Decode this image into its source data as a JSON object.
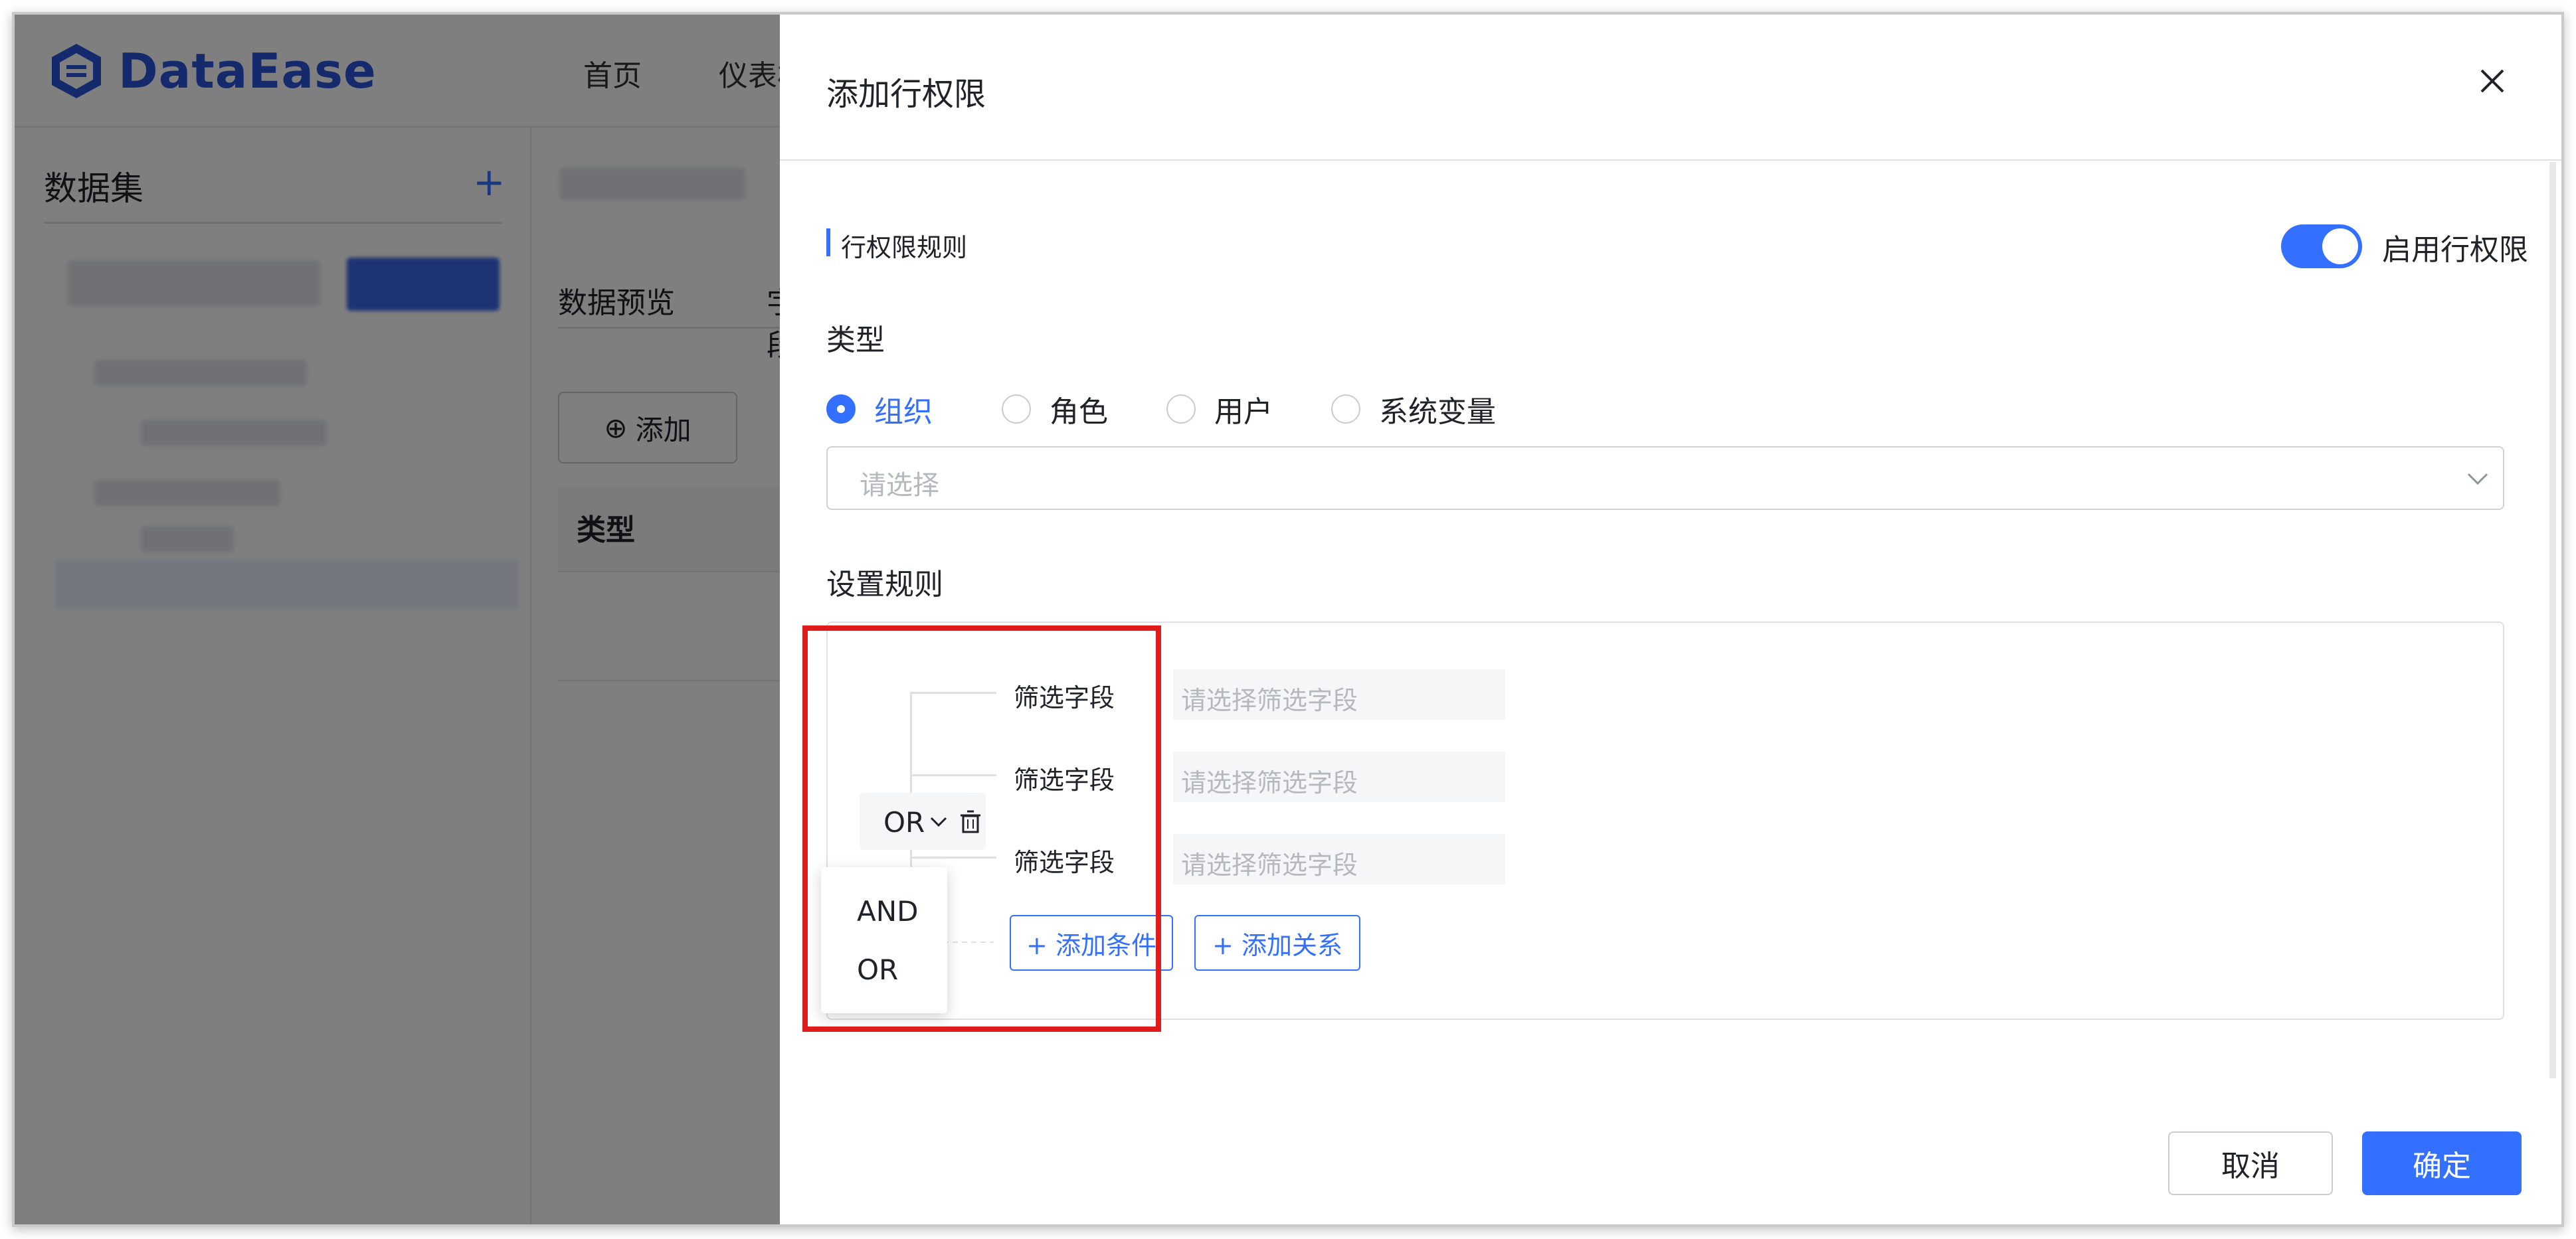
{
  "app": {
    "logo_text": "DataEase",
    "nav": [
      "首页",
      "仪表板"
    ]
  },
  "sidebar": {
    "title": "数据集",
    "add_icon": "plus-icon"
  },
  "content": {
    "tabs": [
      "数据预览",
      "字段"
    ],
    "add_button": "添加",
    "table_header_type": "类型"
  },
  "drawer": {
    "title": "添加行权限",
    "section_title": "行权限规则",
    "toggle_label": "启用行权限",
    "toggle_on": true,
    "type_label": "类型",
    "type_options": [
      "组织",
      "角色",
      "用户",
      "系统变量"
    ],
    "type_selected": "组织",
    "select_placeholder": "请选择",
    "rules_label": "设置规则",
    "relation_value": "OR",
    "relation_menu": [
      "AND",
      "OR"
    ],
    "conditions": [
      {
        "label": "筛选字段",
        "placeholder": "请选择筛选字段"
      },
      {
        "label": "筛选字段",
        "placeholder": "请选择筛选字段"
      },
      {
        "label": "筛选字段",
        "placeholder": "请选择筛选字段"
      }
    ],
    "add_condition": "+ 添加条件",
    "add_relation": "+ 添加关系",
    "cancel": "取消",
    "confirm": "确定"
  },
  "colors": {
    "accent": "#3370ff",
    "highlight": "#e01b1b",
    "brand": "#2a54d8"
  }
}
